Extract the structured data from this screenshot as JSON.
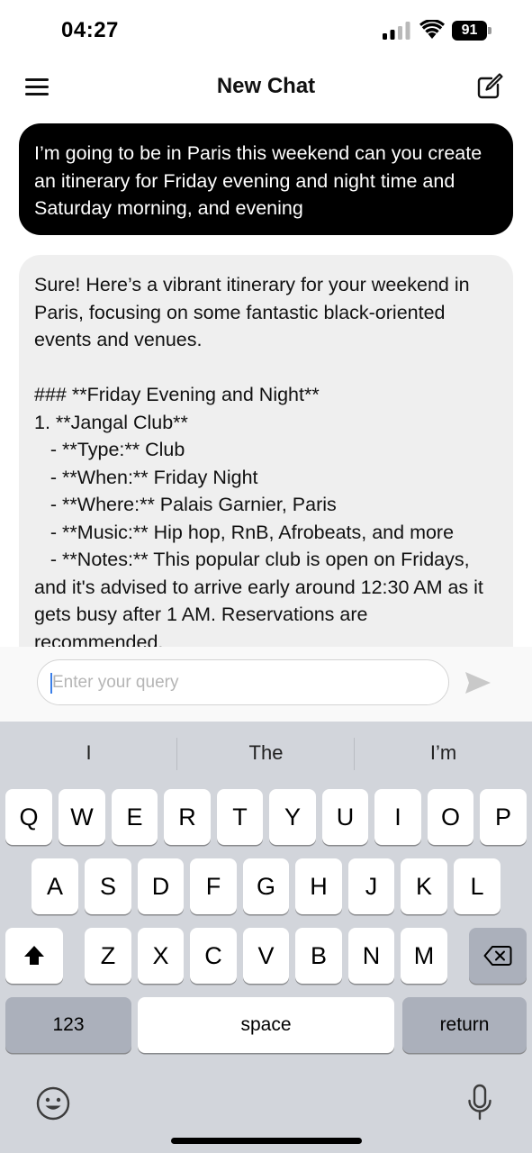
{
  "status_bar": {
    "time": "04:27",
    "battery": "91"
  },
  "header": {
    "title": "New Chat"
  },
  "messages": [
    {
      "role": "user",
      "text": "I’m going to be in Paris this weekend can you create an itinerary for Friday evening and night time and Saturday morning, and evening"
    },
    {
      "role": "assistant",
      "text": "Sure! Here’s a vibrant itinerary for your weekend in Paris, focusing on some fantastic black-oriented events and venues.\n\n### **Friday Evening and Night**\n1. **Jangal Club**\n   - **Type:** Club\n   - **When:** Friday Night\n   - **Where:** Palais Garnier, Paris\n   - **Music:** Hip hop, RnB, Afrobeats, and more\n   - **Notes:** This popular club is open on Fridays, and it's advised to arrive early around 12:30 AM as it gets busy after 1 AM. Reservations are recommended."
    }
  ],
  "composer": {
    "placeholder": "Enter your query",
    "value": ""
  },
  "keyboard": {
    "suggestions": [
      "I",
      "The",
      "I’m"
    ],
    "row1": [
      "Q",
      "W",
      "E",
      "R",
      "T",
      "Y",
      "U",
      "I",
      "O",
      "P"
    ],
    "row2": [
      "A",
      "S",
      "D",
      "F",
      "G",
      "H",
      "J",
      "K",
      "L"
    ],
    "row3": [
      "Z",
      "X",
      "C",
      "V",
      "B",
      "N",
      "M"
    ],
    "numbers_label": "123",
    "space_label": "space",
    "return_label": "return"
  },
  "icons": {
    "menu": "menu-icon",
    "compose": "compose-icon",
    "send": "send-icon",
    "shift": "shift-icon",
    "backspace": "backspace-icon",
    "emoji": "emoji-icon",
    "mic": "mic-icon"
  },
  "colors": {
    "user_bubble": "#000000",
    "assistant_bubble": "#efefef",
    "keyboard_bg": "#d2d5db",
    "caret": "#3a7ee8"
  }
}
